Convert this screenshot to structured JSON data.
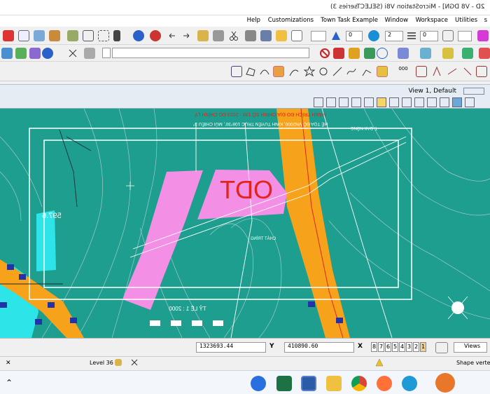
{
  "title": "2D - V8 DGN] - MicroStation V8i (SELECTseries 3)",
  "menu": [
    "Help",
    "Customizations",
    "Town Task Example",
    "Window",
    "Workspace",
    "Utilities",
    "s"
  ],
  "toolbar": {
    "level_combo": "0",
    "weight_combo": "2",
    "style_combo": "0"
  },
  "view": {
    "title": "View 1, Default"
  },
  "map": {
    "zone_code": "ODT",
    "parcel_id": "597.6",
    "scale_label": "TỶ LỆ 1 : 2000",
    "header_line1": "MẢNH TRÍCH ĐO ĐỊA CHÍNH SỐ 139 - 2023 ĐO CHỈNH LÝ",
    "header_line2": "HỆ TỌA ĐỘ VN2000, KINH TUYẾN TRỤC 108°30', MÚI CHIẾU 3°",
    "place": "T. ĐAK NÔNG",
    "area_label": "CHÁT TRÍNG"
  },
  "status": {
    "views_label": "Views",
    "x_label": "X",
    "x_value": "410890.60",
    "y_label": "Y",
    "y_value": "1323693.44",
    "view_buttons": [
      "8",
      "7",
      "6",
      "5",
      "4",
      "3",
      "2",
      "1"
    ],
    "active_level": "Level 36",
    "prompt": "Shape vertex"
  },
  "colors": {
    "canvas": "#1d9e8e",
    "road": "#f7a21b",
    "pink": "#f48fe6",
    "red": "#e3241b"
  },
  "taskbar": [
    "zalo-icon",
    "excel-icon",
    "microstation-icon",
    "explorer-icon",
    "chrome-icon",
    "firefox-icon",
    "edge-icon",
    "game-icon"
  ]
}
